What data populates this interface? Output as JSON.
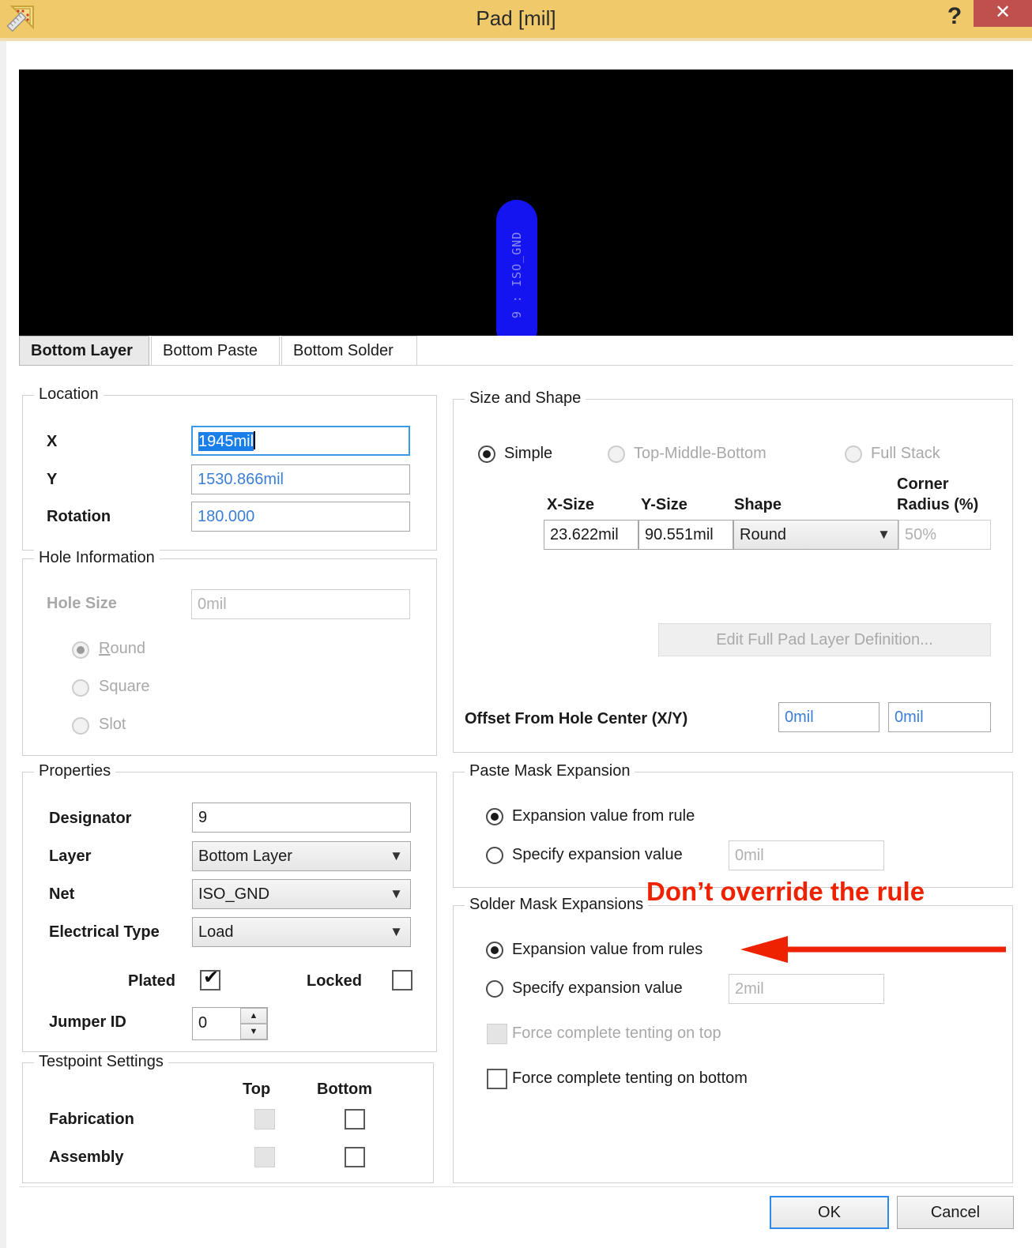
{
  "window": {
    "title": "Pad [mil]",
    "icon": "pcb-ruler-icon",
    "help_label": "?",
    "close_label": "✕",
    "titlebar_color": "#efc96a",
    "close_color": "#c0504d"
  },
  "preview": {
    "pad_label": "9 : ISO_GND",
    "pad_color": "#1414f0",
    "background": "#000000"
  },
  "tabs": [
    {
      "label": "Bottom Layer",
      "active": true
    },
    {
      "label": "Bottom Paste",
      "active": false
    },
    {
      "label": "Bottom Solder",
      "active": false
    }
  ],
  "location": {
    "title": "Location",
    "x_label": "X",
    "x_value": "1945mil",
    "y_label": "Y",
    "y_value": "1530.866mil",
    "rotation_label": "Rotation",
    "rotation_value": "180.000"
  },
  "hole_information": {
    "title": "Hole Information",
    "hole_size_label": "Hole Size",
    "hole_size_value": "0mil",
    "shapes": [
      {
        "label": "Round",
        "selected": true
      },
      {
        "label": "Square",
        "selected": false
      },
      {
        "label": "Slot",
        "selected": false
      }
    ]
  },
  "properties": {
    "title": "Properties",
    "designator_label": "Designator",
    "designator_value": "9",
    "layer_label": "Layer",
    "layer_value": "Bottom Layer",
    "net_label": "Net",
    "net_value": "ISO_GND",
    "electrical_type_label": "Electrical Type",
    "electrical_type_value": "Load",
    "plated_label": "Plated",
    "plated_checked": true,
    "locked_label": "Locked",
    "locked_checked": false,
    "jumper_id_label": "Jumper ID",
    "jumper_id_value": "0"
  },
  "testpoint_settings": {
    "title": "Testpoint Settings",
    "col_top": "Top",
    "col_bottom": "Bottom",
    "rows": [
      {
        "label": "Fabrication",
        "top_checked": false,
        "bottom_checked": false
      },
      {
        "label": "Assembly",
        "top_checked": false,
        "bottom_checked": false
      }
    ]
  },
  "size_and_shape": {
    "title": "Size and Shape",
    "modes": [
      {
        "label": "Simple",
        "selected": true
      },
      {
        "label": "Top-Middle-Bottom",
        "selected": false
      },
      {
        "label": "Full Stack",
        "selected": false
      }
    ],
    "col_x_size": "X-Size",
    "col_y_size": "Y-Size",
    "col_shape": "Shape",
    "col_corner_radius_line1": "Corner",
    "col_corner_radius_line2": "Radius (%)",
    "x_size_value": "23.622mil",
    "y_size_value": "90.551mil",
    "shape_value": "Round",
    "corner_radius_value": "50%",
    "edit_full_pad_button": "Edit Full Pad Layer Definition...",
    "offset_label": "Offset From Hole Center (X/Y)",
    "offset_x_value": "0mil",
    "offset_y_value": "0mil"
  },
  "paste_mask_expansion": {
    "title": "Paste Mask Expansion",
    "from_rule_label": "Expansion value from rule",
    "from_rule_selected": true,
    "specify_label": "Specify expansion value",
    "specify_selected": false,
    "specify_value": "0mil"
  },
  "solder_mask_expansions": {
    "title": "Solder Mask Expansions",
    "from_rules_label": "Expansion value from rules",
    "from_rules_selected": true,
    "specify_label": "Specify expansion value",
    "specify_selected": false,
    "specify_value": "2mil",
    "tent_top_label": "Force complete tenting on top",
    "tent_top_checked": false,
    "tent_bottom_label": "Force complete tenting on bottom",
    "tent_bottom_checked": false
  },
  "annotation": {
    "text": "Don’t override the rule",
    "color": "#ee2200"
  },
  "footer": {
    "ok_label": "OK",
    "cancel_label": "Cancel"
  }
}
